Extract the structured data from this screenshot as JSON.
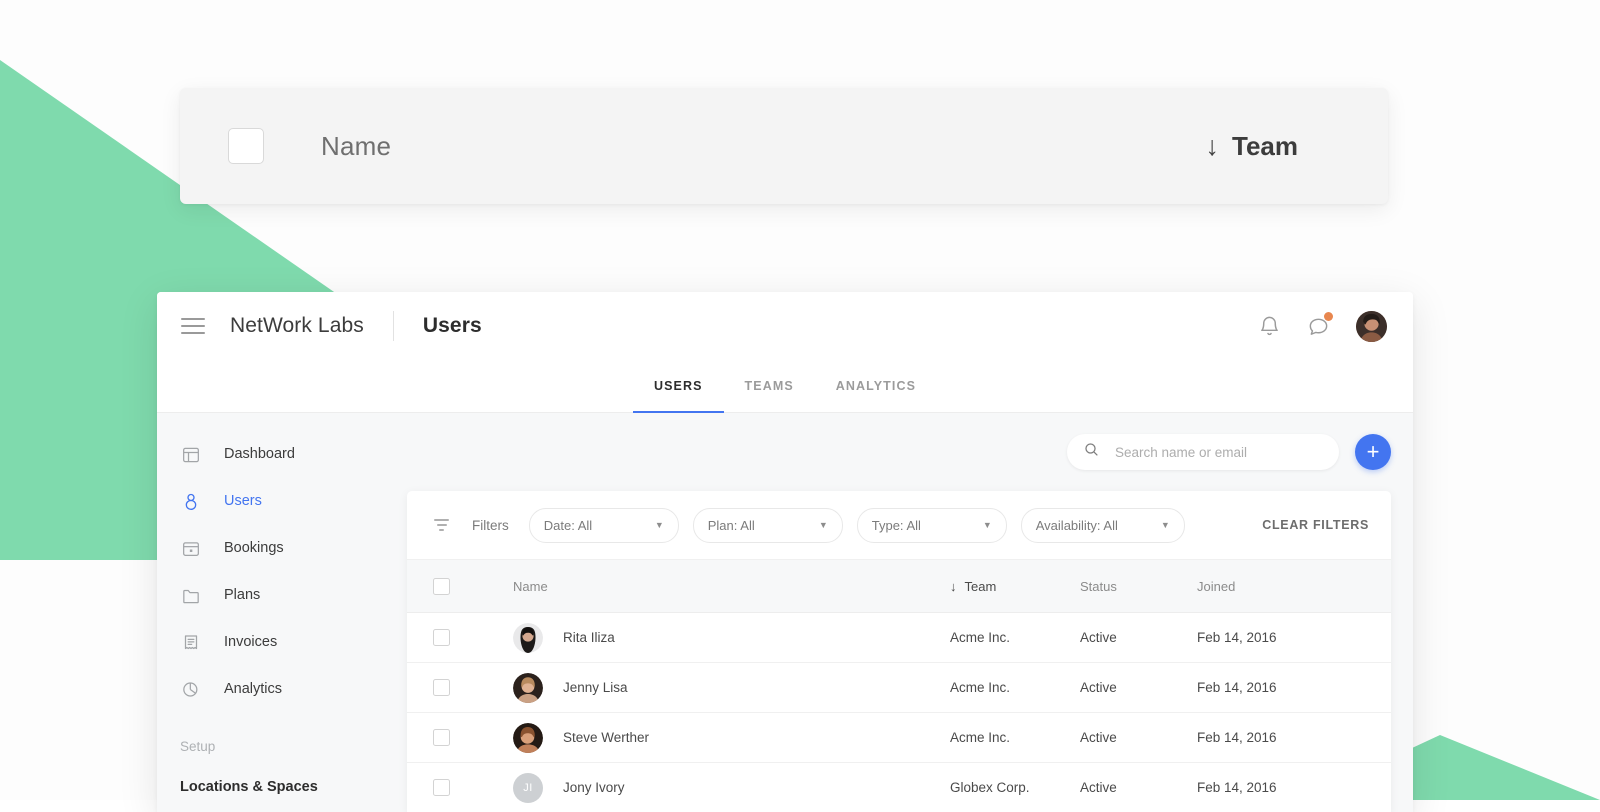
{
  "theme": {
    "accent_blue": "#4375f0",
    "accent_green": "#7fdaad",
    "badge_orange": "#e8874f",
    "panel_bg": "#f7f8f9"
  },
  "float_card": {
    "name_label": "Name",
    "team_label": "Team",
    "sort_arrow": "↓"
  },
  "topbar": {
    "menu_icon": "hamburger-icon",
    "brand": "NetWork Labs",
    "page_title": "Users",
    "notifications_icon": "bell-icon",
    "messages_icon": "chat-bubble-icon",
    "avatar": "user-avatar"
  },
  "tabs": [
    {
      "label": "USERS",
      "active": true
    },
    {
      "label": "TEAMS",
      "active": false
    },
    {
      "label": "ANALYTICS",
      "active": false
    }
  ],
  "sidebar": {
    "items": [
      {
        "label": "Dashboard",
        "icon": "dashboard-icon",
        "active": false
      },
      {
        "label": "Users",
        "icon": "user-icon",
        "active": true
      },
      {
        "label": "Bookings",
        "icon": "calendar-icon",
        "active": false
      },
      {
        "label": "Plans",
        "icon": "folder-icon",
        "active": false
      },
      {
        "label": "Invoices",
        "icon": "receipt-icon",
        "active": false
      },
      {
        "label": "Analytics",
        "icon": "pie-chart-icon",
        "active": false
      }
    ],
    "section_label": "Setup",
    "setup_items": [
      {
        "label": "Locations & Spaces"
      }
    ]
  },
  "search": {
    "placeholder": "Search name or email",
    "value": "",
    "icon": "search-icon"
  },
  "add_button": {
    "label": "+",
    "name": "add-user-button"
  },
  "filters": {
    "label": "Filters",
    "icon": "filter-icon",
    "chips": [
      {
        "label": "Date: All",
        "caret": "▼"
      },
      {
        "label": "Plan: All",
        "caret": "▼"
      },
      {
        "label": "Type: All",
        "caret": "▼"
      },
      {
        "label": "Availability: All",
        "caret": "▼"
      }
    ],
    "clear_label": "CLEAR FILTERS"
  },
  "table": {
    "columns": {
      "name": "Name",
      "team": "Team",
      "status": "Status",
      "joined": "Joined"
    },
    "sorted_column": "Team",
    "sort_arrow": "↓",
    "rows": [
      {
        "name": "Rita Iliza",
        "team": "Acme Inc.",
        "status": "Active",
        "joined": "Feb 14, 2016",
        "avatar_type": "photo",
        "avatar_bg": "#2e2a28",
        "initials": ""
      },
      {
        "name": "Jenny Lisa",
        "team": "Acme Inc.",
        "status": "Active",
        "joined": "Feb 14, 2016",
        "avatar_type": "photo",
        "avatar_bg": "#8a6a54",
        "initials": ""
      },
      {
        "name": "Steve Werther",
        "team": "Acme Inc.",
        "status": "Active",
        "joined": "Feb 14, 2016",
        "avatar_type": "photo",
        "avatar_bg": "#6b4632",
        "initials": ""
      },
      {
        "name": "Jony Ivory",
        "team": "Globex Corp.",
        "status": "Active",
        "joined": "Feb 14, 2016",
        "avatar_type": "initials",
        "avatar_bg": "#cdd0d3",
        "initials": "JI"
      }
    ]
  }
}
